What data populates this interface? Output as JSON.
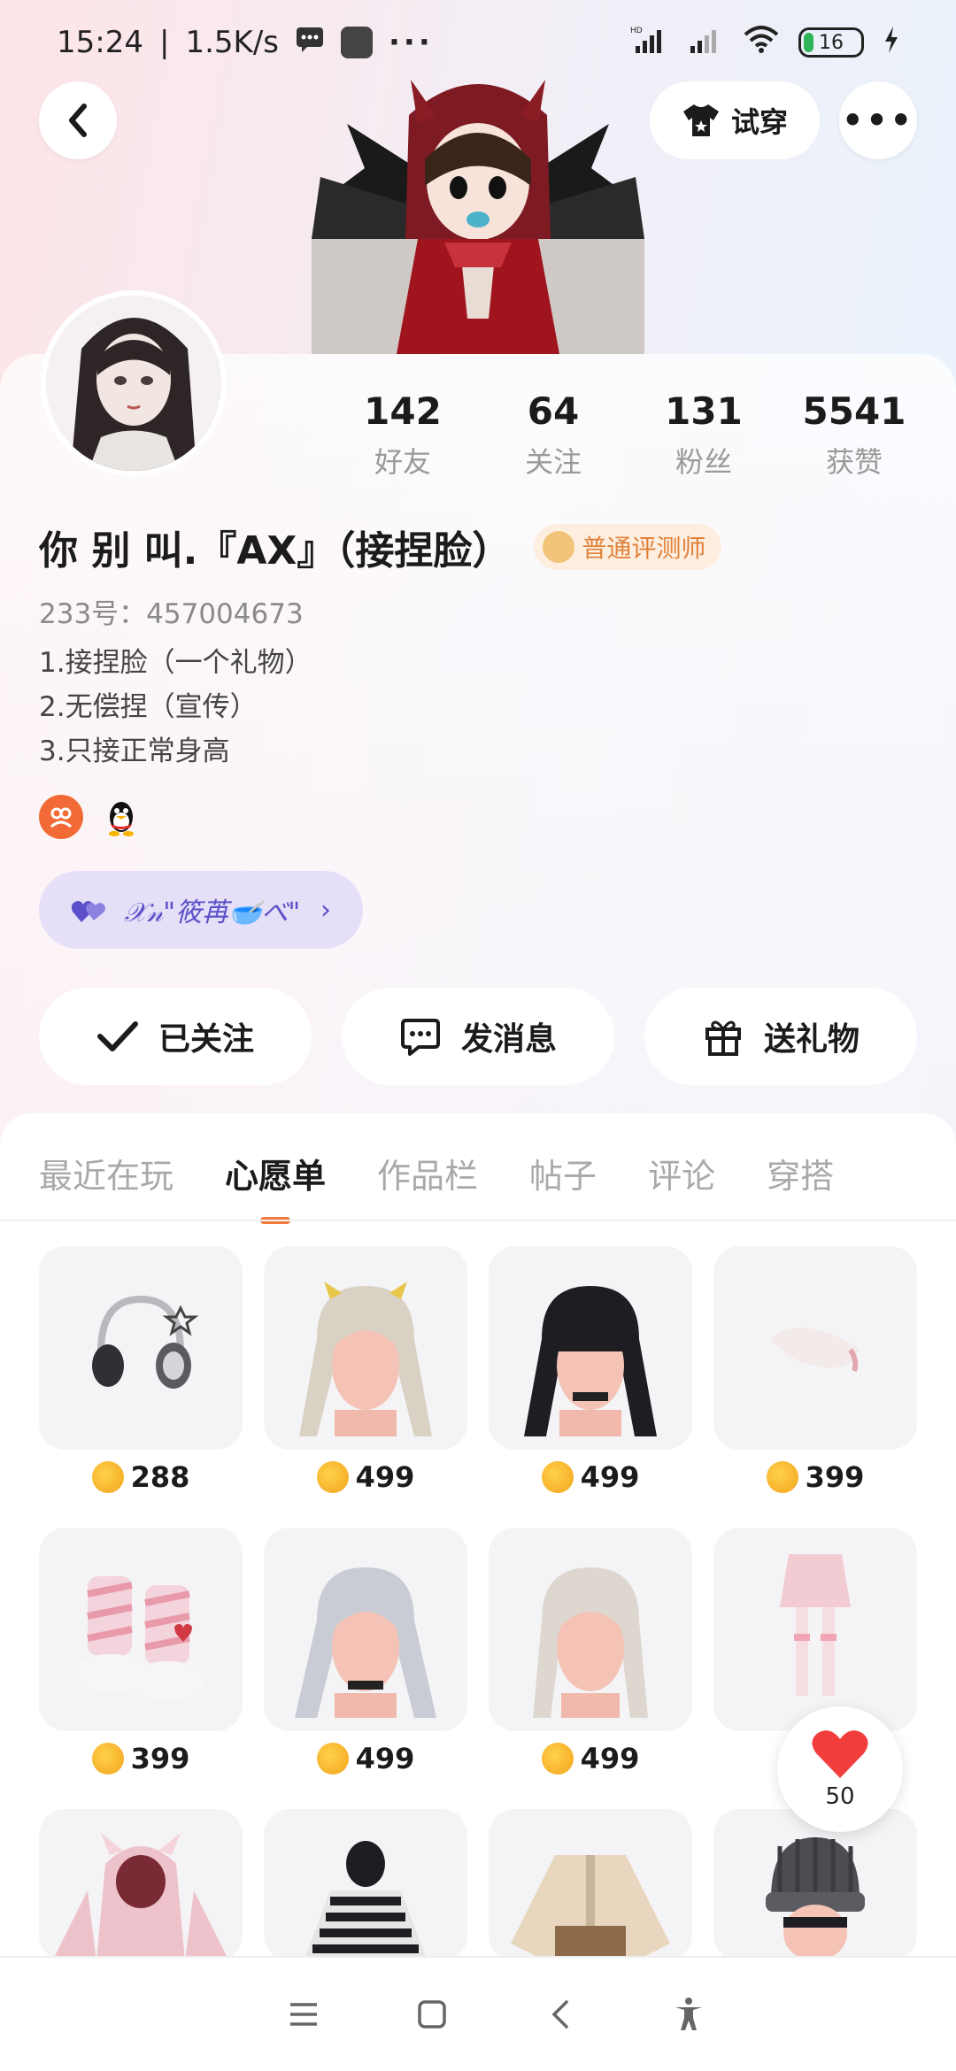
{
  "status_bar": {
    "time": "15:24",
    "net_speed": "1.5K/s",
    "battery": "16"
  },
  "header": {
    "try_on_label": "试穿"
  },
  "profile": {
    "stats": [
      {
        "value": "142",
        "label": "好友"
      },
      {
        "value": "64",
        "label": "关注"
      },
      {
        "value": "131",
        "label": "粉丝"
      },
      {
        "value": "5541",
        "label": "获赞"
      }
    ],
    "nickname": "你 别 叫.『AX』（接捏脸）",
    "badge": "普通评测师",
    "uid": "233号：457004673",
    "bio": [
      "1.接捏脸（一个礼物）",
      "2.无偿捏（宣传）",
      "3.只接正常身高"
    ],
    "fan_tag": "𝒳𝓃\"筱苒🥣べ\""
  },
  "actions": {
    "follow": "已关注",
    "message": "发消息",
    "gift": "送礼物"
  },
  "tabs": [
    "最近在玩",
    "心愿单",
    "作品栏",
    "帖子",
    "评论",
    "穿搭"
  ],
  "active_tab": "心愿单",
  "wishlist": [
    {
      "icon": "headphones",
      "price": "288"
    },
    {
      "icon": "hair-blonde-horns",
      "price": "499"
    },
    {
      "icon": "hair-black-twintails",
      "price": "499"
    },
    {
      "icon": "feather-wing",
      "price": "399"
    },
    {
      "icon": "striped-boots",
      "price": "399"
    },
    {
      "icon": "hair-silver-twintails",
      "price": "499"
    },
    {
      "icon": "hair-platinum-long",
      "price": "499"
    },
    {
      "icon": "pink-skirt-stockings",
      "price": ""
    },
    {
      "icon": "pink-bunny-hoodie",
      "price": null
    },
    {
      "icon": "striped-sweater",
      "price": null
    },
    {
      "icon": "beige-coat",
      "price": null
    },
    {
      "icon": "grey-beanie",
      "price": null
    }
  ],
  "like_count": "50",
  "colors": {
    "accent": "#f07a3c",
    "badge_text": "#e0813a",
    "fan_tag_bg": "#e5e0f7",
    "fan_tag_text": "#5b50c9"
  }
}
